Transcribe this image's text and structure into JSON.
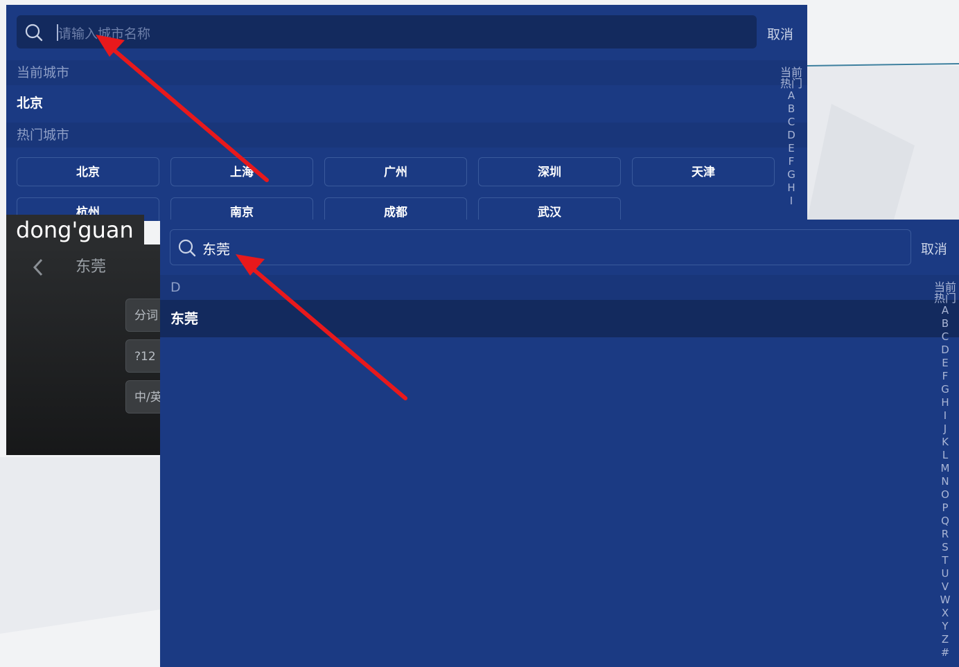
{
  "top_panel": {
    "search_placeholder": "请输入城市名称",
    "cancel_label": "取消",
    "current_city_header": "当前城市",
    "current_city": "北京",
    "hot_cities_header": "热门城市",
    "hot_cities_row1": [
      "北京",
      "上海",
      "广州",
      "深圳",
      "天津"
    ],
    "hot_cities_row2": [
      "杭州",
      "南京",
      "成都",
      "武汉"
    ],
    "index_head": [
      "当前",
      "热门"
    ],
    "index_letters": [
      "A",
      "B",
      "C",
      "D",
      "E",
      "F",
      "G",
      "H",
      "I"
    ]
  },
  "keyboard": {
    "pinyin_preview": "dong'guan",
    "candidate_word": "东莞",
    "keys": [
      "分词",
      "?12",
      "中/英"
    ]
  },
  "bottom_panel": {
    "search_value": "东莞",
    "cancel_label": "取消",
    "section_letter": "D",
    "result": "东莞",
    "index_head": [
      "当前",
      "热门"
    ],
    "index_letters": [
      "A",
      "B",
      "C",
      "D",
      "E",
      "F",
      "G",
      "H",
      "I",
      "J",
      "K",
      "L",
      "M",
      "N",
      "O",
      "P",
      "Q",
      "R",
      "S",
      "T",
      "U",
      "V",
      "W",
      "X",
      "Y",
      "Z",
      "#"
    ]
  },
  "colors": {
    "panel_bg": "#1b3a83",
    "search_bg": "#132a5e",
    "annotation_arrow": "#e8191c"
  }
}
